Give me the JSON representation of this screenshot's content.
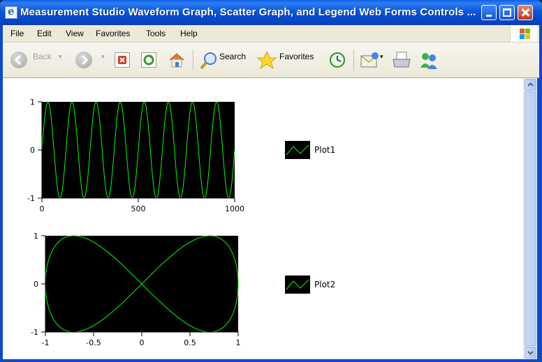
{
  "window": {
    "title": "Measurement Studio Waveform Graph, Scatter Graph, and Legend Web Forms Controls ..."
  },
  "menu": [
    "File",
    "Edit",
    "View",
    "Favorites",
    "Tools",
    "Help"
  ],
  "toolbar": {
    "back": "Back",
    "search": "Search",
    "favorites": "Favorites"
  },
  "colors": {
    "plot_bg": "#000000",
    "trace": "#00ff00"
  },
  "chart_data": [
    {
      "type": "line",
      "x": {
        "min": 0,
        "max": 1000,
        "ticks": [
          "0",
          "500",
          "1000"
        ]
      },
      "y": {
        "min": -1,
        "max": 1,
        "ticks": [
          "1",
          "0",
          "-1"
        ]
      },
      "series": [
        {
          "name": "Plot1",
          "function": "sine",
          "cycles": 8,
          "amplitude": 1
        }
      ],
      "grid": false
    },
    {
      "type": "scatter",
      "x": {
        "min": -1,
        "max": 1,
        "ticks": [
          "-1",
          "-0.5",
          "0",
          "0.5",
          "1"
        ]
      },
      "y": {
        "min": -1,
        "max": 1,
        "ticks": [
          "1",
          "0",
          "-1"
        ]
      },
      "series": [
        {
          "name": "Plot2",
          "shape": "figure-eight",
          "x_function": "sin(t)",
          "y_function": "sin(2t)"
        }
      ],
      "grid": false
    }
  ],
  "legend": {
    "plot1": "Plot1",
    "plot2": "Plot2"
  }
}
